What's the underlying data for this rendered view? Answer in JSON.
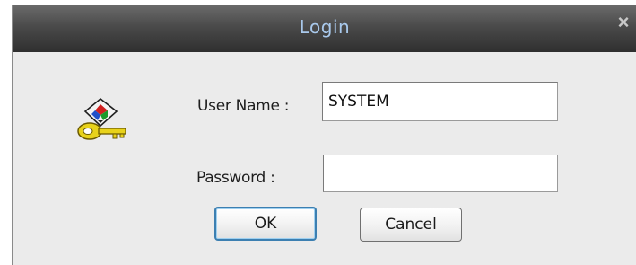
{
  "dialog": {
    "title": "Login",
    "close_glyph": "×",
    "icon": "key-login-icon"
  },
  "form": {
    "username_label": "User Name :",
    "username_value": "SYSTEM",
    "password_label": "Password :",
    "password_value": ""
  },
  "buttons": {
    "ok_label": "OK",
    "cancel_label": "Cancel"
  },
  "colors": {
    "title_text": "#a9c9ec",
    "titlebar": "#3f3f3f",
    "dialog_bg": "#ebebeb",
    "default_button_border": "#3c7fb1"
  }
}
